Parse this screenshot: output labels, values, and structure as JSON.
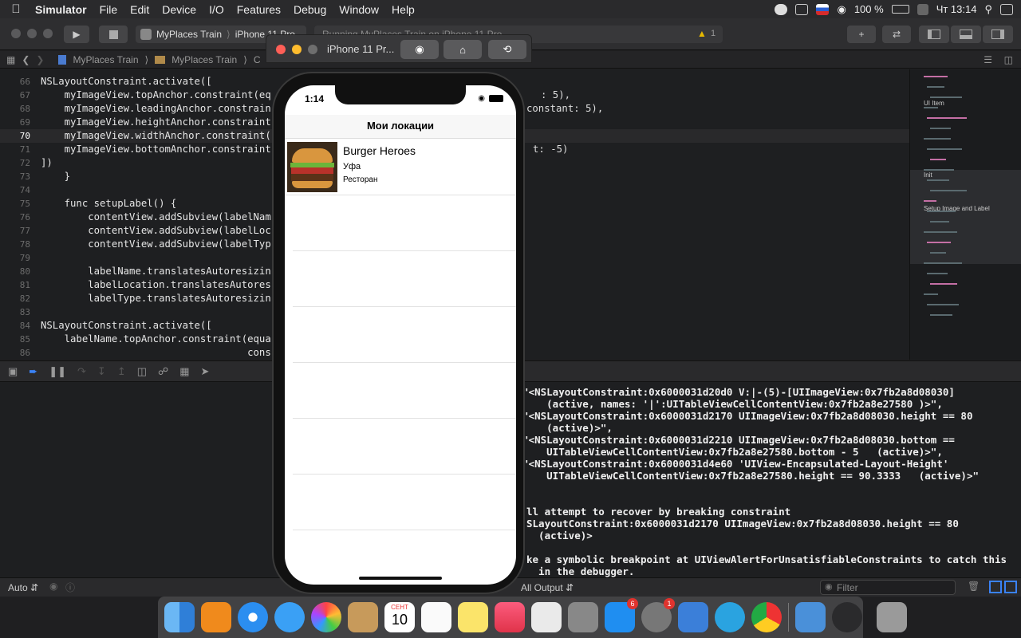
{
  "menubar": {
    "app": "Simulator",
    "items": [
      "File",
      "Edit",
      "Device",
      "I/O",
      "Features",
      "Debug",
      "Window",
      "Help"
    ],
    "battery": "100 %",
    "clock": "Чт 13:14"
  },
  "toolbar": {
    "scheme": "MyPlaces Train",
    "device": "iPhone 11 Pro",
    "status": "Running MyPlaces Train on iPhone 11 Pro",
    "warnings": "1"
  },
  "jumpbar": {
    "crumbs": [
      "MyPlaces Train",
      "MyPlaces Train",
      "C"
    ]
  },
  "editor": {
    "lines": [
      {
        "n": "66",
        "html": "NSLayoutConstraint.activate(["
      },
      {
        "n": "67",
        "html": "    myImageView.topAnchor.constraint(eq"
      },
      {
        "n": "68",
        "html": "    myImageView.leadingAnchor.constrain"
      },
      {
        "n": "69",
        "html": "    myImageView.heightAnchor.constraint"
      },
      {
        "n": "70",
        "html": "    myImageView.widthAnchor.constraint("
      },
      {
        "n": "71",
        "html": "    myImageView.bottomAnchor.constraint"
      },
      {
        "n": "72",
        "html": "])"
      },
      {
        "n": "73",
        "html": "    }"
      },
      {
        "n": "74",
        "html": ""
      },
      {
        "n": "75",
        "html": "    func setupLabel() {"
      },
      {
        "n": "76",
        "html": "        contentView.addSubview(labelNam"
      },
      {
        "n": "77",
        "html": "        contentView.addSubview(labelLoc"
      },
      {
        "n": "78",
        "html": "        contentView.addSubview(labelTyp"
      },
      {
        "n": "79",
        "html": ""
      },
      {
        "n": "80",
        "html": "        labelName.translatesAutoresizin"
      },
      {
        "n": "81",
        "html": "        labelLocation.translatesAutores"
      },
      {
        "n": "82",
        "html": "        labelType.translatesAutoresizin"
      },
      {
        "n": "83",
        "html": ""
      },
      {
        "n": "84",
        "html": "NSLayoutConstraint.activate(["
      },
      {
        "n": "85",
        "html": "    labelName.topAnchor.constraint(equa"
      },
      {
        "n": "86",
        "html": "                                   cons"
      }
    ],
    "right_fragments": [
      ": 5),",
      "constant: 5),",
      "",
      "",
      "t: -5)"
    ]
  },
  "minimap": {
    "labels": [
      "UI Item",
      "Init",
      "Setup Image and Label"
    ]
  },
  "console": {
    "lines": [
      "  \"<NSLayoutConstraint:0x6000031d20d0 V:|-(5)-[UIImageView:0x7fb2a8d08030]",
      "      (active, names: '|':UITableViewCellContentView:0x7fb2a8e27580 )>\",",
      "  \"<NSLayoutConstraint:0x6000031d2170 UIImageView:0x7fb2a8d08030.height == 80",
      "      (active)>\",",
      "  \"<NSLayoutConstraint:0x6000031d2210 UIImageView:0x7fb2a8d08030.bottom ==",
      "      UITableViewCellContentView:0x7fb2a8e27580.bottom - 5   (active)>\",",
      "  \"<NSLayoutConstraint:0x6000031d4e60 'UIView-Encapsulated-Layout-Height'",
      "      UITableViewCellContentView:0x7fb2a8e27580.height == 90.3333   (active)>\"",
      "",
      "",
      "ll attempt to recover by breaking constraint",
      "SLayoutConstraint:0x6000031d2170 UIImageView:0x7fb2a8d08030.height == 80",
      "  (active)>",
      "",
      "ke a symbolic breakpoint at UIViewAlertForUnsatisfiableConstraints to catch this",
      "  in the debugger."
    ]
  },
  "bottom": {
    "auto": "Auto",
    "output": "All Output",
    "filter_placeholder": "Filter"
  },
  "dock": {
    "calendar_month": "СЕНТ",
    "calendar_day": "10",
    "badges": {
      "appstore": "6",
      "prefs": "1"
    }
  },
  "simulator": {
    "title": "iPhone 11 Pr...",
    "time": "1:14",
    "nav_title": "Мои локации",
    "places": [
      {
        "name": "Burger Heroes",
        "location": "Уфа",
        "type": "Ресторан"
      }
    ],
    "empty_rows": 6
  }
}
